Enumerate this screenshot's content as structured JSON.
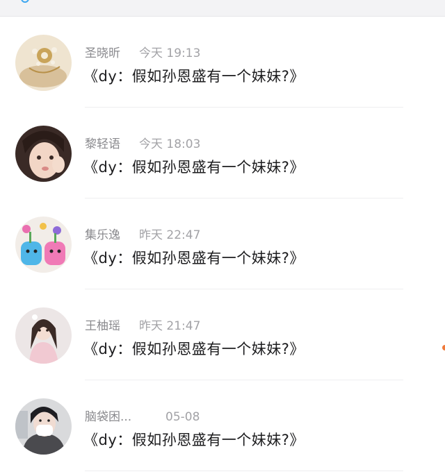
{
  "colors": {
    "background": "#ffffff",
    "name_text": "#8a8a8e",
    "message_text": "#1c1c1e",
    "accent_dot": "#f07a3a"
  },
  "messages": [
    {
      "avatar": "brooch-avatar",
      "name": "圣晓昕",
      "time": "今天 19:13",
      "text": "《dy：假如孙恩盛有一个妹妹?》"
    },
    {
      "avatar": "girl-selfie-avatar",
      "name": "黎轻语",
      "time": "今天 18:03",
      "text": "《dy：假如孙恩盛有一个妹妹?》"
    },
    {
      "avatar": "plush-toys-avatar",
      "name": "集乐逸",
      "time": "昨天 22:47",
      "text": "《dy：假如孙恩盛有一个妹妹?》"
    },
    {
      "avatar": "girl-pink-avatar",
      "name": "王柚瑶",
      "time": "昨天 21:47",
      "text": "《dy：假如孙恩盛有一个妹妹?》"
    },
    {
      "avatar": "girl-mask-avatar",
      "name": "脑袋困...",
      "time": "05-08",
      "text": "《dy：假如孙恩盛有一个妹妹?》"
    }
  ]
}
